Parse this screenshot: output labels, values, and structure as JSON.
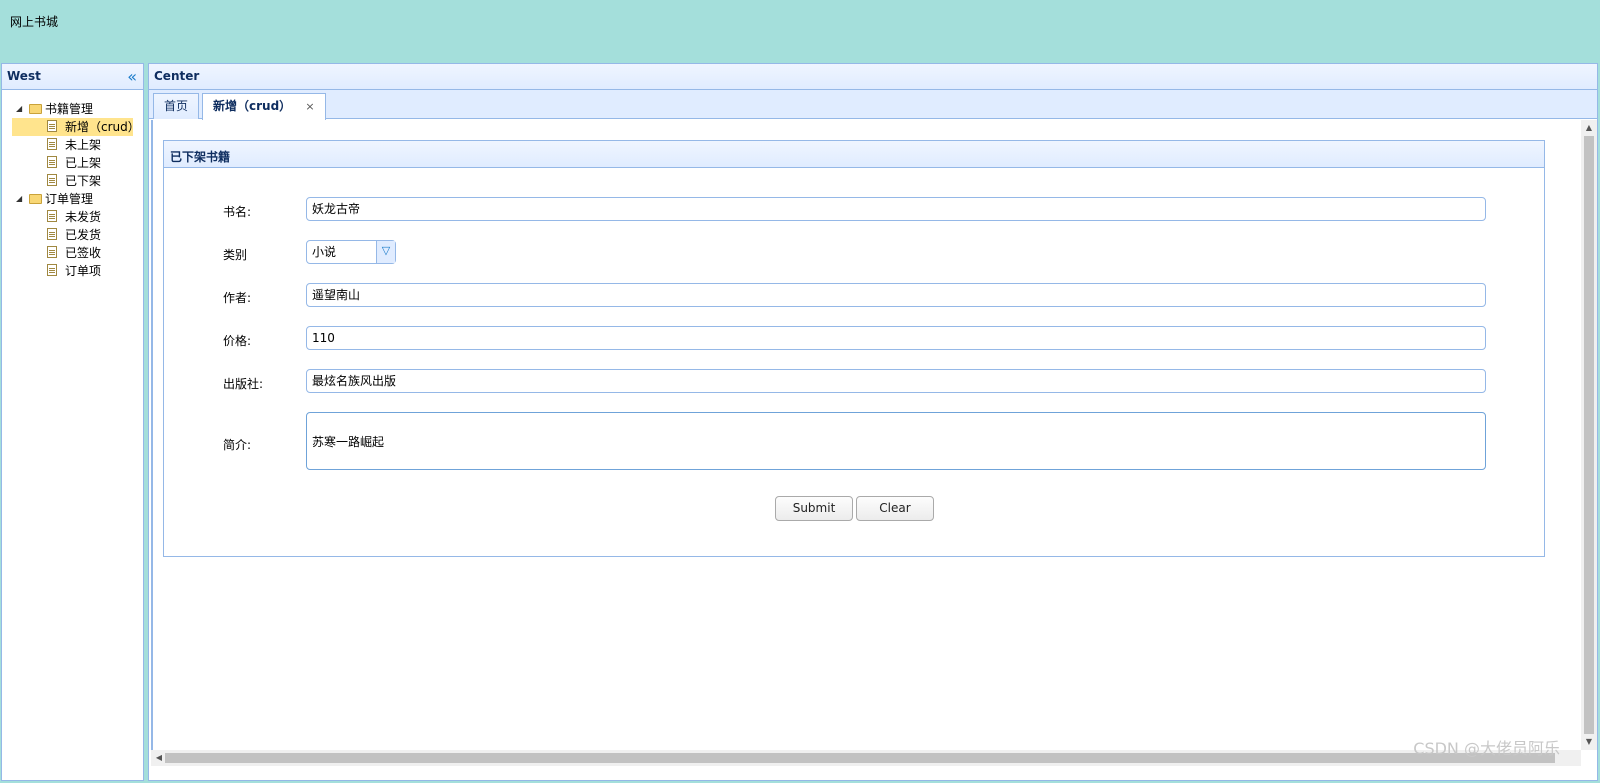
{
  "app": {
    "title": "网上书城"
  },
  "west": {
    "title": "West",
    "tree": [
      {
        "label": "书籍管理",
        "children": [
          "新增（crud）",
          "未上架",
          "已上架",
          "已下架"
        ]
      },
      {
        "label": "订单管理",
        "children": [
          "未发货",
          "已发货",
          "已签收",
          "订单项"
        ]
      }
    ],
    "selected": "新增（crud）"
  },
  "center": {
    "title": "Center",
    "tabs": [
      {
        "label": "首页",
        "closable": false
      },
      {
        "label": "新增（crud）",
        "closable": true,
        "close": "×"
      }
    ]
  },
  "form": {
    "panel_title": "已下架书籍",
    "fields": {
      "name": {
        "label": "书名:",
        "value": "妖龙古帝"
      },
      "category": {
        "label": "类别",
        "value": "小说"
      },
      "author": {
        "label": "作者:",
        "value": "遥望南山"
      },
      "price": {
        "label": "价格:",
        "value": "110"
      },
      "publisher": {
        "label": "出版社:",
        "value": "最炫名族风出版"
      },
      "intro": {
        "label": "简介:",
        "value": "苏寒一路崛起"
      }
    },
    "submit_label": "Submit",
    "clear_label": "Clear"
  },
  "watermark": "CSDN @大佬员阿乐",
  "colors": {
    "north_bg": "#a4dfdb",
    "border": "#95b8e7",
    "selected": "#ffe48d"
  }
}
